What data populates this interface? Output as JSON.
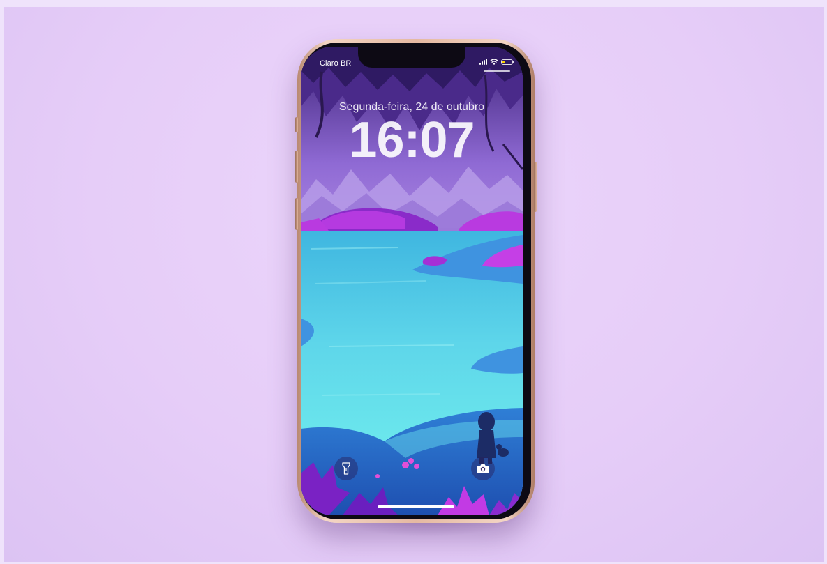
{
  "status_bar": {
    "carrier": "Claro BR",
    "signal_bars": 4,
    "wifi_icon": "wifi-icon",
    "battery_icon": "battery-icon",
    "battery_level": 0.25,
    "battery_color": "#ffd400"
  },
  "lock_screen": {
    "date": "Segunda-feira, 24 de outubro",
    "time": "16:07"
  },
  "quick_actions": {
    "left_icon": "flashlight-icon",
    "right_icon": "camera-icon"
  },
  "colors": {
    "background": "#e9d3fa",
    "phone_frame": "#e5b9a2",
    "sky": "#a886e0",
    "lake": "#5fdce8",
    "foliage": "#b02ad6"
  }
}
